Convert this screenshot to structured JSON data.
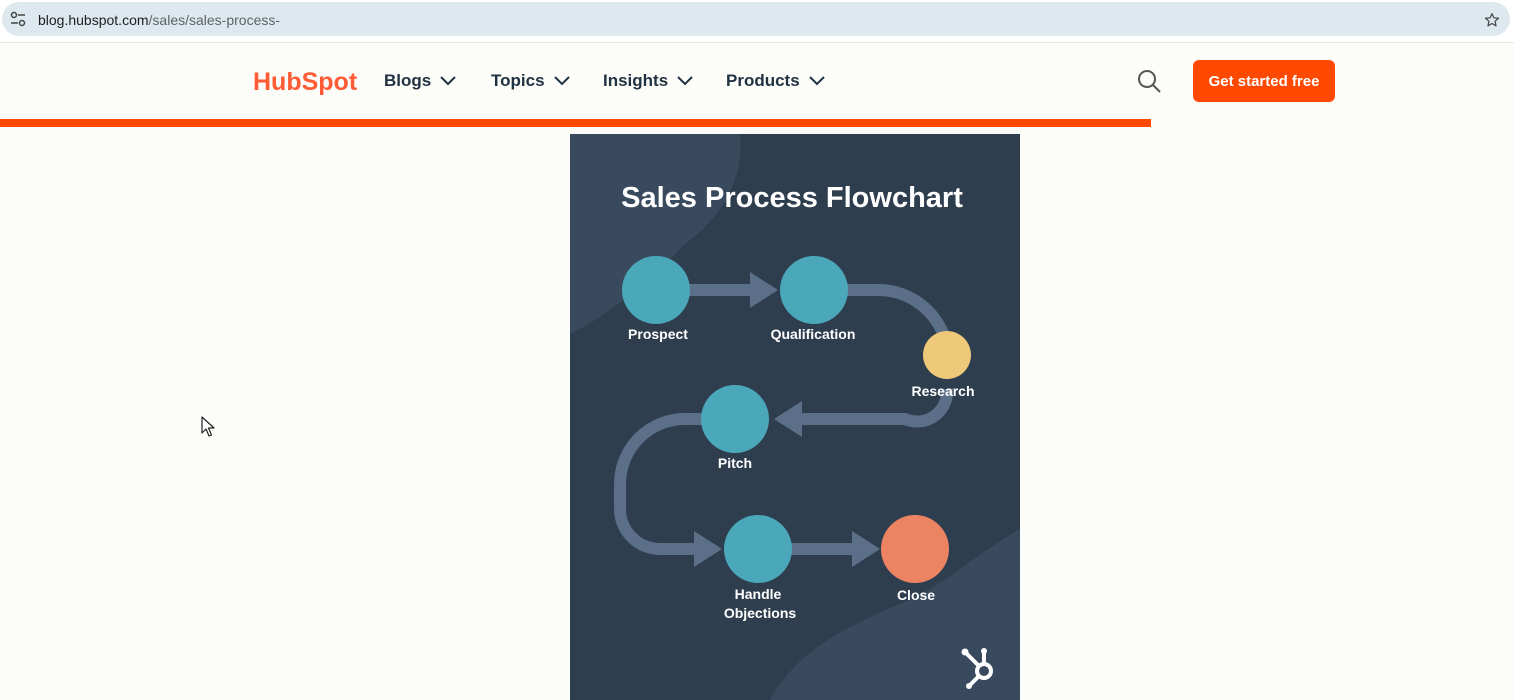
{
  "browser": {
    "url_host": "blog.hubspot.com",
    "url_path": "/sales/sales-process-",
    "icons": {
      "site_info": "tune-icon",
      "bookmark": "star-icon"
    }
  },
  "header": {
    "logo_text": "HubSpot",
    "nav": [
      {
        "label": "Blogs"
      },
      {
        "label": "Topics"
      },
      {
        "label": "Insights"
      },
      {
        "label": "Products"
      }
    ],
    "cta_label": "Get started free",
    "search_icon": "search-icon",
    "reading_progress_percent": 76
  },
  "flowchart": {
    "title": "Sales Process Flowchart",
    "steps": [
      {
        "label": "Prospect",
        "color": "#4ba8bb"
      },
      {
        "label": "Qualification",
        "color": "#4ba8bb"
      },
      {
        "label": "Research",
        "color": "#eec97a"
      },
      {
        "label": "Pitch",
        "color": "#4ba8bb"
      },
      {
        "label_line1": "Handle",
        "label_line2": "Objections",
        "color": "#4ba8bb"
      },
      {
        "label": "Close",
        "color": "#ec8463"
      }
    ],
    "background_color": "#2f3e4e",
    "connector_color": "#5b6f88",
    "brand_icon": "hubspot-sprocket-icon"
  },
  "colors": {
    "accent": "#ff4800",
    "nav_text": "#213343"
  }
}
